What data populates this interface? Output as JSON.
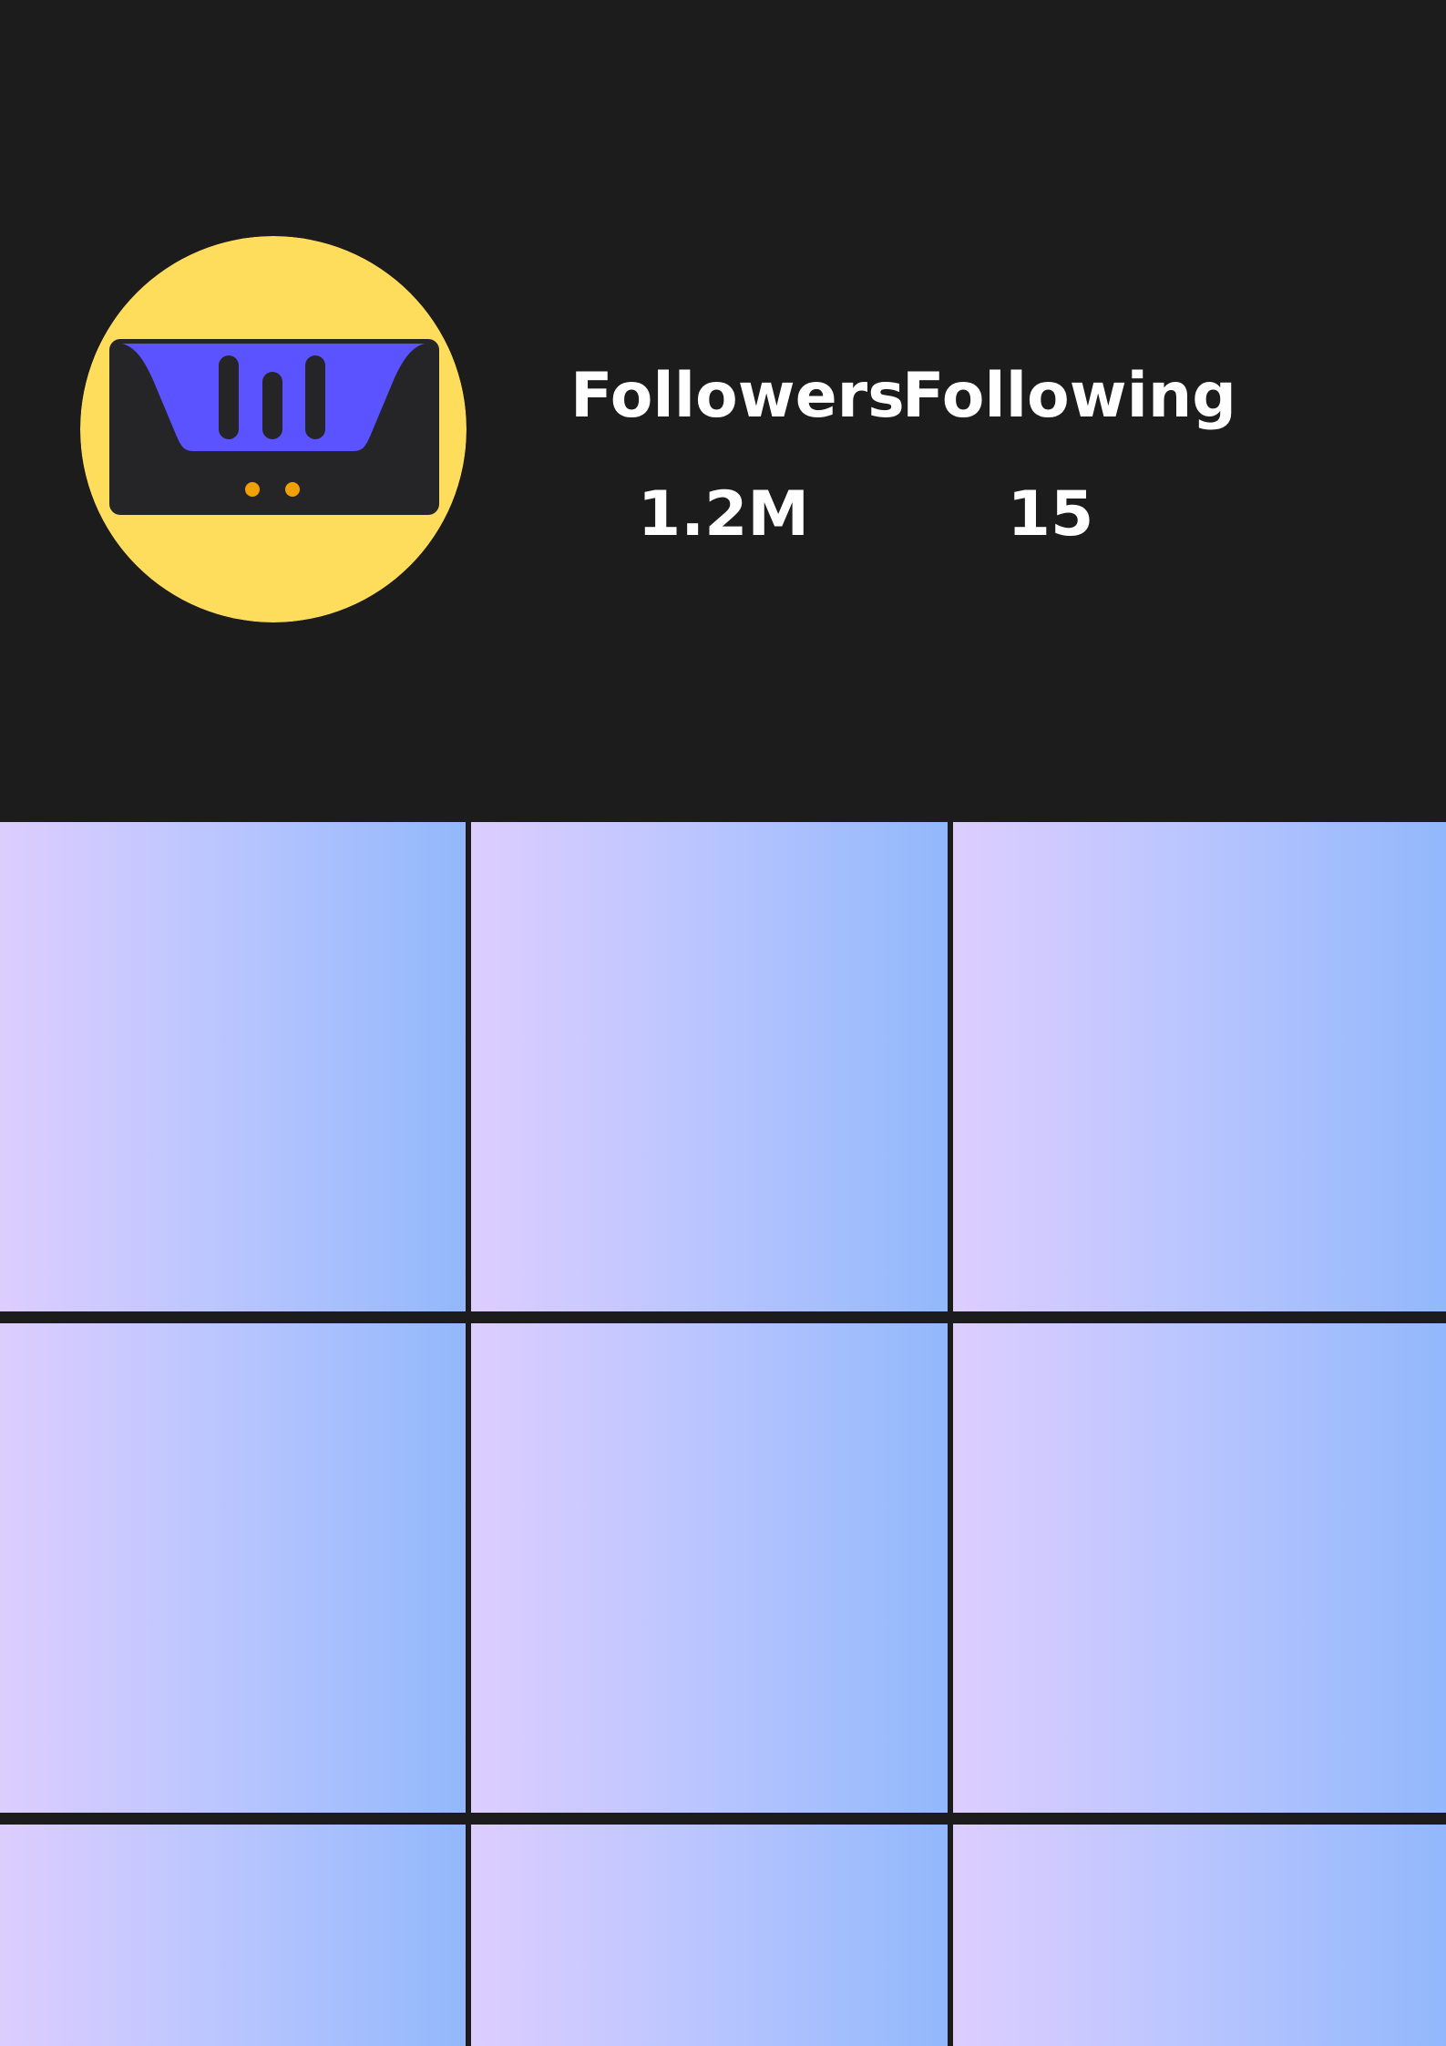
{
  "profile": {
    "avatar_icon": "shopping-basket-logo-icon",
    "stats": {
      "followers_label": "Followers",
      "followers_value": "1.2M",
      "following_label": "Following",
      "following_value": "15"
    }
  },
  "colors": {
    "background": "#1c1c1c",
    "avatar_circle": "#ffdd5c",
    "basket_body": "#252527",
    "basket_top": "#5b53ff",
    "basket_dots": "#f1a106",
    "tile_gradient_start": "#ddcdff",
    "tile_gradient_end": "#92b8fb"
  },
  "grid": {
    "rows": 3,
    "columns": 3,
    "tiles": [
      {
        "label": ""
      },
      {
        "label": ""
      },
      {
        "label": ""
      },
      {
        "label": ""
      },
      {
        "label": ""
      },
      {
        "label": ""
      },
      {
        "label": ""
      },
      {
        "label": ""
      },
      {
        "label": ""
      }
    ]
  }
}
